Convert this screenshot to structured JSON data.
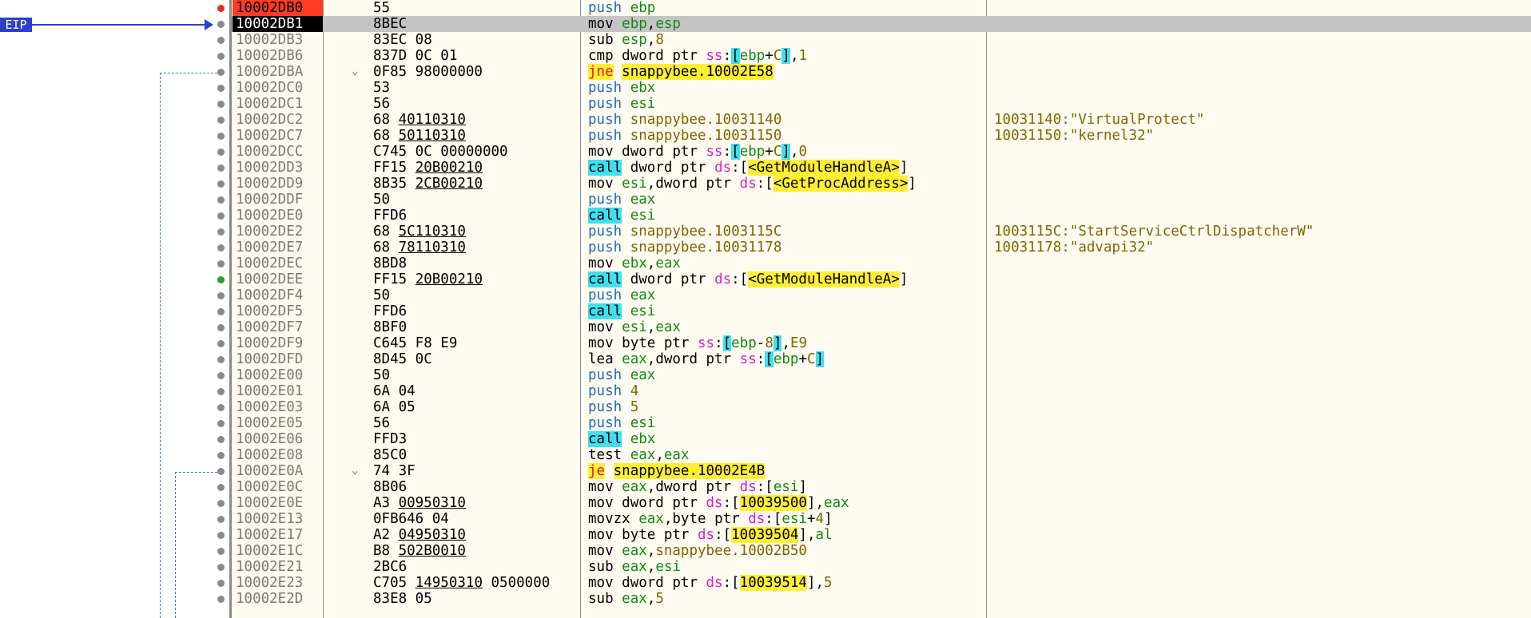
{
  "eip_label": "EIP",
  "colors": {
    "breakpoint": "#ff3c22",
    "eip_highlight": "#000000",
    "current_row": "#c4c4c4",
    "listing_bg": "#fffbf0",
    "call_highlight": "#3ee0f0",
    "jump_highlight": "#ffef33",
    "arrow": "#2a3fd0"
  },
  "rows": [
    {
      "addr": "10002DB0",
      "state": "bp",
      "bytes": [
        {
          "t": "55"
        }
      ],
      "dis": [
        {
          "t": "push",
          "c": "push"
        },
        {
          "t": " "
        },
        {
          "t": "ebp",
          "c": "reg"
        }
      ]
    },
    {
      "addr": "10002DB1",
      "state": "eip",
      "bytes": [
        {
          "t": "8BEC"
        }
      ],
      "dis": [
        {
          "t": "mov",
          "c": "mnem"
        },
        {
          "t": " "
        },
        {
          "t": "ebp",
          "c": "reg"
        },
        {
          "t": ","
        },
        {
          "t": "esp",
          "c": "reg"
        }
      ]
    },
    {
      "addr": "10002DB3",
      "bytes": [
        {
          "t": "83EC 08"
        }
      ],
      "dis": [
        {
          "t": "sub"
        },
        {
          "t": " "
        },
        {
          "t": "esp",
          "c": "reg"
        },
        {
          "t": ","
        },
        {
          "t": "8",
          "c": "num"
        }
      ]
    },
    {
      "addr": "10002DB6",
      "bytes": [
        {
          "t": "837D 0C 01"
        }
      ],
      "dis": [
        {
          "t": "cmp"
        },
        {
          "t": " "
        },
        {
          "t": "dword ptr "
        },
        {
          "t": "ss",
          "c": "seg"
        },
        {
          "t": ":"
        },
        {
          "t": "[",
          "c": "brk"
        },
        {
          "t": "ebp",
          "c": "reg"
        },
        {
          "t": "+"
        },
        {
          "t": "C",
          "c": "num"
        },
        {
          "t": "]",
          "c": "brk"
        },
        {
          "t": ","
        },
        {
          "t": "1",
          "c": "num"
        }
      ]
    },
    {
      "addr": "10002DBA",
      "jump": true,
      "bytes": [
        {
          "t": "0F85 98000000"
        }
      ],
      "dis": [
        {
          "t": "jne",
          "c": "jm"
        },
        {
          "t": " "
        },
        {
          "t": "snappybee.10002E58",
          "c": "hly"
        }
      ]
    },
    {
      "addr": "10002DC0",
      "bytes": [
        {
          "t": "53"
        }
      ],
      "dis": [
        {
          "t": "push",
          "c": "push"
        },
        {
          "t": " "
        },
        {
          "t": "ebx",
          "c": "reg"
        }
      ]
    },
    {
      "addr": "10002DC1",
      "bytes": [
        {
          "t": "56"
        }
      ],
      "dis": [
        {
          "t": "push",
          "c": "push"
        },
        {
          "t": " "
        },
        {
          "t": "esi",
          "c": "reg"
        }
      ]
    },
    {
      "addr": "10002DC2",
      "bytes": [
        {
          "t": "68 "
        },
        {
          "t": "40110310",
          "u": true
        }
      ],
      "dis": [
        {
          "t": "push",
          "c": "push"
        },
        {
          "t": " "
        },
        {
          "t": "snappybee.10031140",
          "c": "sym"
        }
      ],
      "cmt": "10031140:\"VirtualProtect\""
    },
    {
      "addr": "10002DC7",
      "bytes": [
        {
          "t": "68 "
        },
        {
          "t": "50110310",
          "u": true
        }
      ],
      "dis": [
        {
          "t": "push",
          "c": "push"
        },
        {
          "t": " "
        },
        {
          "t": "snappybee.10031150",
          "c": "sym"
        }
      ],
      "cmt": "10031150:\"kernel32\""
    },
    {
      "addr": "10002DCC",
      "bytes": [
        {
          "t": "C745 0C 00000000"
        }
      ],
      "dis": [
        {
          "t": "mov"
        },
        {
          "t": " "
        },
        {
          "t": "dword ptr "
        },
        {
          "t": "ss",
          "c": "seg"
        },
        {
          "t": ":"
        },
        {
          "t": "[",
          "c": "brk"
        },
        {
          "t": "ebp",
          "c": "reg"
        },
        {
          "t": "+"
        },
        {
          "t": "C",
          "c": "num"
        },
        {
          "t": "]",
          "c": "brk"
        },
        {
          "t": ","
        },
        {
          "t": "0",
          "c": "num"
        }
      ]
    },
    {
      "addr": "10002DD3",
      "bytes": [
        {
          "t": "FF15 "
        },
        {
          "t": "20B00210",
          "u": true
        }
      ],
      "dis": [
        {
          "t": "call",
          "c": "callm"
        },
        {
          "t": " "
        },
        {
          "t": "dword ptr "
        },
        {
          "t": "ds",
          "c": "seg"
        },
        {
          "t": ":["
        },
        {
          "t": "<GetModuleHandleA>",
          "c": "hly"
        },
        {
          "t": "]"
        }
      ]
    },
    {
      "addr": "10002DD9",
      "bytes": [
        {
          "t": "8B35 "
        },
        {
          "t": "2CB00210",
          "u": true
        }
      ],
      "dis": [
        {
          "t": "mov"
        },
        {
          "t": " "
        },
        {
          "t": "esi",
          "c": "reg"
        },
        {
          "t": ","
        },
        {
          "t": "dword ptr "
        },
        {
          "t": "ds",
          "c": "seg"
        },
        {
          "t": ":["
        },
        {
          "t": "<GetProcAddress>",
          "c": "hly"
        },
        {
          "t": "]"
        }
      ]
    },
    {
      "addr": "10002DDF",
      "bytes": [
        {
          "t": "50"
        }
      ],
      "dis": [
        {
          "t": "push",
          "c": "push"
        },
        {
          "t": " "
        },
        {
          "t": "eax",
          "c": "reg"
        }
      ]
    },
    {
      "addr": "10002DE0",
      "bytes": [
        {
          "t": "FFD6"
        }
      ],
      "dis": [
        {
          "t": "call",
          "c": "callm"
        },
        {
          "t": " "
        },
        {
          "t": "esi",
          "c": "reg"
        }
      ]
    },
    {
      "addr": "10002DE2",
      "bytes": [
        {
          "t": "68 "
        },
        {
          "t": "5C110310",
          "u": true
        }
      ],
      "dis": [
        {
          "t": "push",
          "c": "push"
        },
        {
          "t": " "
        },
        {
          "t": "snappybee.1003115C",
          "c": "sym"
        }
      ],
      "cmt": "1003115C:\"StartServiceCtrlDispatcherW\""
    },
    {
      "addr": "10002DE7",
      "bytes": [
        {
          "t": "68 "
        },
        {
          "t": "78110310",
          "u": true
        }
      ],
      "dis": [
        {
          "t": "push",
          "c": "push"
        },
        {
          "t": " "
        },
        {
          "t": "snappybee.10031178",
          "c": "sym"
        }
      ],
      "cmt": "10031178:\"advapi32\""
    },
    {
      "addr": "10002DEC",
      "bytes": [
        {
          "t": "8BD8"
        }
      ],
      "dis": [
        {
          "t": "mov"
        },
        {
          "t": " "
        },
        {
          "t": "ebx",
          "c": "reg"
        },
        {
          "t": ","
        },
        {
          "t": "eax",
          "c": "reg"
        }
      ]
    },
    {
      "addr": "10002DEE",
      "dot": "green",
      "bytes": [
        {
          "t": "FF15 "
        },
        {
          "t": "20B00210",
          "u": true
        }
      ],
      "dis": [
        {
          "t": "call",
          "c": "callm"
        },
        {
          "t": " "
        },
        {
          "t": "dword ptr "
        },
        {
          "t": "ds",
          "c": "seg"
        },
        {
          "t": ":["
        },
        {
          "t": "<GetModuleHandleA>",
          "c": "hly"
        },
        {
          "t": "]"
        }
      ]
    },
    {
      "addr": "10002DF4",
      "bytes": [
        {
          "t": "50"
        }
      ],
      "dis": [
        {
          "t": "push",
          "c": "push"
        },
        {
          "t": " "
        },
        {
          "t": "eax",
          "c": "reg"
        }
      ]
    },
    {
      "addr": "10002DF5",
      "bytes": [
        {
          "t": "FFD6"
        }
      ],
      "dis": [
        {
          "t": "call",
          "c": "callm"
        },
        {
          "t": " "
        },
        {
          "t": "esi",
          "c": "reg"
        }
      ]
    },
    {
      "addr": "10002DF7",
      "bytes": [
        {
          "t": "8BF0"
        }
      ],
      "dis": [
        {
          "t": "mov"
        },
        {
          "t": " "
        },
        {
          "t": "esi",
          "c": "reg"
        },
        {
          "t": ","
        },
        {
          "t": "eax",
          "c": "reg"
        }
      ]
    },
    {
      "addr": "10002DF9",
      "bytes": [
        {
          "t": "C645 F8 E9"
        }
      ],
      "dis": [
        {
          "t": "mov"
        },
        {
          "t": " "
        },
        {
          "t": "byte ptr "
        },
        {
          "t": "ss",
          "c": "seg"
        },
        {
          "t": ":"
        },
        {
          "t": "[",
          "c": "brk"
        },
        {
          "t": "ebp",
          "c": "reg"
        },
        {
          "t": "-"
        },
        {
          "t": "8",
          "c": "num"
        },
        {
          "t": "]",
          "c": "brk"
        },
        {
          "t": ","
        },
        {
          "t": "E9",
          "c": "num"
        }
      ]
    },
    {
      "addr": "10002DFD",
      "bytes": [
        {
          "t": "8D45 0C"
        }
      ],
      "dis": [
        {
          "t": "lea"
        },
        {
          "t": " "
        },
        {
          "t": "eax",
          "c": "reg"
        },
        {
          "t": ","
        },
        {
          "t": "dword ptr "
        },
        {
          "t": "ss",
          "c": "seg"
        },
        {
          "t": ":"
        },
        {
          "t": "[",
          "c": "brk"
        },
        {
          "t": "ebp",
          "c": "reg"
        },
        {
          "t": "+"
        },
        {
          "t": "C",
          "c": "num"
        },
        {
          "t": "]",
          "c": "brk"
        }
      ]
    },
    {
      "addr": "10002E00",
      "bytes": [
        {
          "t": "50"
        }
      ],
      "dis": [
        {
          "t": "push",
          "c": "push"
        },
        {
          "t": " "
        },
        {
          "t": "eax",
          "c": "reg"
        }
      ]
    },
    {
      "addr": "10002E01",
      "bytes": [
        {
          "t": "6A 04"
        }
      ],
      "dis": [
        {
          "t": "push",
          "c": "push"
        },
        {
          "t": " "
        },
        {
          "t": "4",
          "c": "num"
        }
      ]
    },
    {
      "addr": "10002E03",
      "bytes": [
        {
          "t": "6A 05"
        }
      ],
      "dis": [
        {
          "t": "push",
          "c": "push"
        },
        {
          "t": " "
        },
        {
          "t": "5",
          "c": "num"
        }
      ]
    },
    {
      "addr": "10002E05",
      "bytes": [
        {
          "t": "56"
        }
      ],
      "dis": [
        {
          "t": "push",
          "c": "push"
        },
        {
          "t": " "
        },
        {
          "t": "esi",
          "c": "reg"
        }
      ]
    },
    {
      "addr": "10002E06",
      "bytes": [
        {
          "t": "FFD3"
        }
      ],
      "dis": [
        {
          "t": "call",
          "c": "callm"
        },
        {
          "t": " "
        },
        {
          "t": "ebx",
          "c": "reg"
        }
      ]
    },
    {
      "addr": "10002E08",
      "bytes": [
        {
          "t": "85C0"
        }
      ],
      "dis": [
        {
          "t": "test"
        },
        {
          "t": " "
        },
        {
          "t": "eax",
          "c": "reg"
        },
        {
          "t": ","
        },
        {
          "t": "eax",
          "c": "reg"
        }
      ]
    },
    {
      "addr": "10002E0A",
      "jump": true,
      "bytes": [
        {
          "t": "74 3F"
        }
      ],
      "dis": [
        {
          "t": "je",
          "c": "jm"
        },
        {
          "t": " "
        },
        {
          "t": "snappybee.10002E4B",
          "c": "hly"
        }
      ]
    },
    {
      "addr": "10002E0C",
      "bytes": [
        {
          "t": "8B06"
        }
      ],
      "dis": [
        {
          "t": "mov"
        },
        {
          "t": " "
        },
        {
          "t": "eax",
          "c": "reg"
        },
        {
          "t": ","
        },
        {
          "t": "dword ptr "
        },
        {
          "t": "ds",
          "c": "seg"
        },
        {
          "t": ":["
        },
        {
          "t": "esi",
          "c": "reg"
        },
        {
          "t": "]"
        }
      ]
    },
    {
      "addr": "10002E0E",
      "bytes": [
        {
          "t": "A3 "
        },
        {
          "t": "00950310",
          "u": true
        }
      ],
      "dis": [
        {
          "t": "mov"
        },
        {
          "t": " "
        },
        {
          "t": "dword ptr "
        },
        {
          "t": "ds",
          "c": "seg"
        },
        {
          "t": ":["
        },
        {
          "t": "10039500",
          "c": "hly"
        },
        {
          "t": "],"
        },
        {
          "t": "eax",
          "c": "reg"
        }
      ]
    },
    {
      "addr": "10002E13",
      "bytes": [
        {
          "t": "0FB646 04"
        }
      ],
      "dis": [
        {
          "t": "movzx"
        },
        {
          "t": " "
        },
        {
          "t": "eax",
          "c": "reg"
        },
        {
          "t": ","
        },
        {
          "t": "byte ptr "
        },
        {
          "t": "ds",
          "c": "seg"
        },
        {
          "t": ":["
        },
        {
          "t": "esi",
          "c": "reg"
        },
        {
          "t": "+"
        },
        {
          "t": "4",
          "c": "num"
        },
        {
          "t": "]"
        }
      ]
    },
    {
      "addr": "10002E17",
      "bytes": [
        {
          "t": "A2 "
        },
        {
          "t": "04950310",
          "u": true
        }
      ],
      "dis": [
        {
          "t": "mov"
        },
        {
          "t": " "
        },
        {
          "t": "byte ptr "
        },
        {
          "t": "ds",
          "c": "seg"
        },
        {
          "t": ":["
        },
        {
          "t": "10039504",
          "c": "hly"
        },
        {
          "t": "],"
        },
        {
          "t": "al",
          "c": "reg"
        }
      ]
    },
    {
      "addr": "10002E1C",
      "bytes": [
        {
          "t": "B8 "
        },
        {
          "t": "502B0010",
          "u": true
        }
      ],
      "dis": [
        {
          "t": "mov"
        },
        {
          "t": " "
        },
        {
          "t": "eax",
          "c": "reg"
        },
        {
          "t": ","
        },
        {
          "t": "snappybee.10002B50",
          "c": "sym"
        }
      ]
    },
    {
      "addr": "10002E21",
      "bytes": [
        {
          "t": "2BC6"
        }
      ],
      "dis": [
        {
          "t": "sub"
        },
        {
          "t": " "
        },
        {
          "t": "eax",
          "c": "reg"
        },
        {
          "t": ","
        },
        {
          "t": "esi",
          "c": "reg"
        }
      ]
    },
    {
      "addr": "10002E23",
      "bytes": [
        {
          "t": "C705 "
        },
        {
          "t": "14950310",
          "u": true
        },
        {
          "t": " 0500000"
        }
      ],
      "dis": [
        {
          "t": "mov"
        },
        {
          "t": " "
        },
        {
          "t": "dword ptr "
        },
        {
          "t": "ds",
          "c": "seg"
        },
        {
          "t": ":["
        },
        {
          "t": "10039514",
          "c": "hly"
        },
        {
          "t": "],"
        },
        {
          "t": "5",
          "c": "num"
        }
      ]
    },
    {
      "addr": "10002E2D",
      "bytes": [
        {
          "t": "83E8 05"
        }
      ],
      "dis": [
        {
          "t": "sub"
        },
        {
          "t": " "
        },
        {
          "t": "eax",
          "c": "reg"
        },
        {
          "t": ","
        },
        {
          "t": "5",
          "c": "num"
        }
      ]
    }
  ]
}
